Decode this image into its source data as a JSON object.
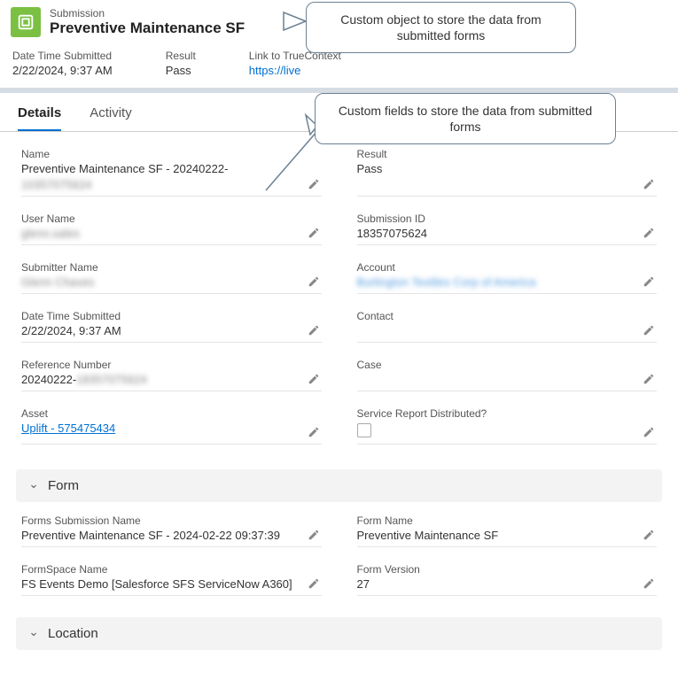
{
  "header": {
    "object_label": "Submission",
    "object_title": "Preventive Maintenance SF"
  },
  "summary": {
    "date_time_submitted_label": "Date Time Submitted",
    "date_time_submitted_value": "2/22/2024, 9:37 AM",
    "result_label": "Result",
    "result_value": "Pass",
    "link_label": "Link to TrueContext",
    "link_value": "https://live"
  },
  "tabs": {
    "details": "Details",
    "activity": "Activity"
  },
  "fields": {
    "name_label": "Name",
    "name_value": "Preventive Maintenance SF - 20240222-",
    "name_blur": "10357075624",
    "result_label": "Result",
    "result_value": "Pass",
    "user_name_label": "User Name",
    "user_name_value": "glenn.sales",
    "submission_id_label": "Submission ID",
    "submission_id_value": "18357075624",
    "submitter_name_label": "Submitter Name",
    "submitter_name_value": "Glenn Chaves",
    "account_label": "Account",
    "account_value": "Burlington Textiles Corp of America",
    "date_time_submitted_label": "Date Time Submitted",
    "date_time_submitted_value": "2/22/2024, 9:37 AM",
    "contact_label": "Contact",
    "reference_number_label": "Reference Number",
    "reference_number_prefix": "20240222-",
    "reference_number_blur": "18357075624",
    "case_label": "Case",
    "asset_label": "Asset",
    "asset_value": "Uplift - 575475434",
    "srd_label": "Service Report Distributed?"
  },
  "sections": {
    "form_title": "Form",
    "location_title": "Location"
  },
  "form_section": {
    "forms_submission_name_label": "Forms Submission Name",
    "forms_submission_name_value": "Preventive Maintenance SF - 2024-02-22 09:37:39",
    "form_name_label": "Form Name",
    "form_name_value": "Preventive Maintenance SF",
    "formspace_name_label": "FormSpace Name",
    "formspace_name_value": "FS Events Demo [Salesforce SFS ServiceNow A360]",
    "form_version_label": "Form Version",
    "form_version_value": "27"
  },
  "callouts": {
    "object": "Custom object to store the data from submitted forms",
    "fields": "Custom fields to store the data from submitted forms"
  }
}
